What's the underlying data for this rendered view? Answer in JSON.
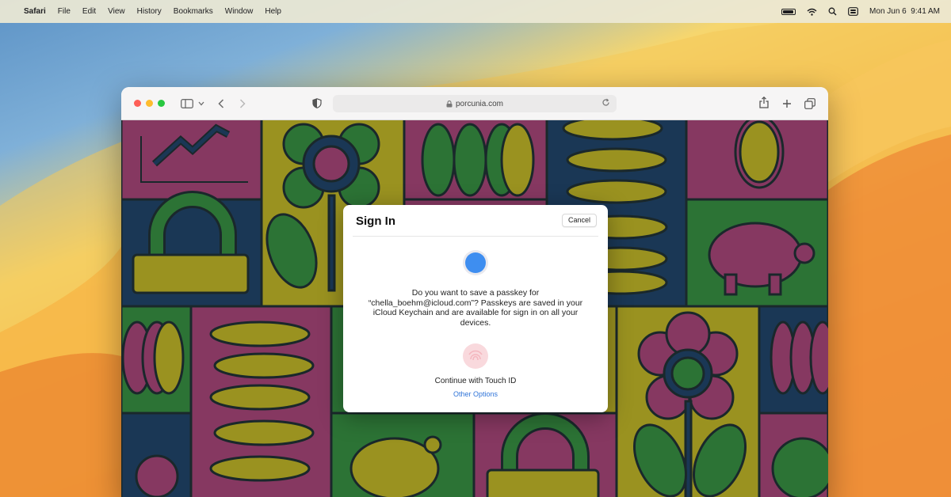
{
  "menubar": {
    "items": [
      "Safari",
      "File",
      "Edit",
      "View",
      "History",
      "Bookmarks",
      "Window",
      "Help"
    ],
    "datetime": "Mon Jun 6  9:41 AM",
    "icons": [
      "apple-icon",
      "battery-icon",
      "wifi-icon",
      "search-icon",
      "control-center-icon"
    ]
  },
  "browser": {
    "url": "porcunia.com",
    "toolbar_icons": [
      "sidebar-icon",
      "chevron-down-icon",
      "back-icon",
      "forward-icon",
      "privacy-shield-icon",
      "reload-icon",
      "share-icon",
      "new-tab-icon",
      "tabs-overview-icon"
    ]
  },
  "dialog": {
    "title": "Sign In",
    "cancel_label": "Cancel",
    "message": "Do you want to save a passkey for “chella_boehm@icloud.com”? Passkeys are saved in your iCloud Keychain and are available for sign in on all your devices.",
    "touch_id_label": "Continue with Touch ID",
    "other_options_label": "Other Options"
  },
  "colors": {
    "magenta": "#8e3b67",
    "olive": "#a39a22",
    "green": "#2f7a38",
    "navy": "#1c3a5a",
    "outline": "#1c2b2e",
    "link": "#2f74d9"
  }
}
